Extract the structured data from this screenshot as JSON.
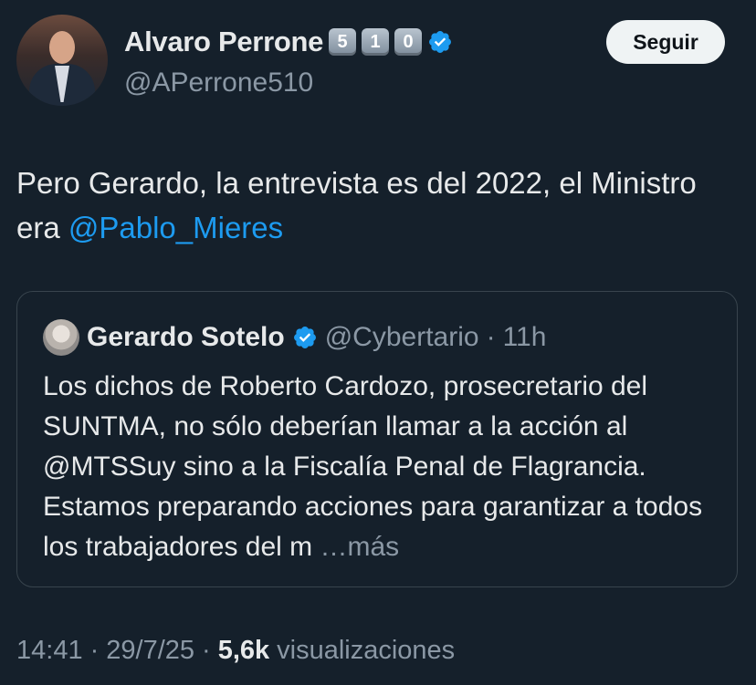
{
  "author": {
    "display_name": "Alvaro Perrone",
    "badges": [
      "5",
      "1",
      "0"
    ],
    "handle": "@APerrone510",
    "verified_color": "#1d9bf0"
  },
  "follow_button": {
    "label": "Seguir"
  },
  "tweet": {
    "text": "Pero Gerardo, la entrevista es del 2022, el Ministro era ",
    "mention": "@Pablo_Mieres"
  },
  "quoted": {
    "display_name": "Gerardo Sotelo",
    "handle": "@Cybertario",
    "separator": "·",
    "time": "11h",
    "text": "Los dichos de Roberto Cardozo, prosecretario del SUNTMA, no sólo deberían llamar a la acción al @MTSSuy sino a la Fiscalía Penal de Flagrancia. Estamos preparando acciones para garantizar a todos los trabajadores del m ",
    "more_label": "…más"
  },
  "meta": {
    "time": "14:41",
    "sep1": "·",
    "date": "29/7/25",
    "sep2": "·",
    "views_count": "5,6k",
    "views_label": "visualizaciones"
  }
}
